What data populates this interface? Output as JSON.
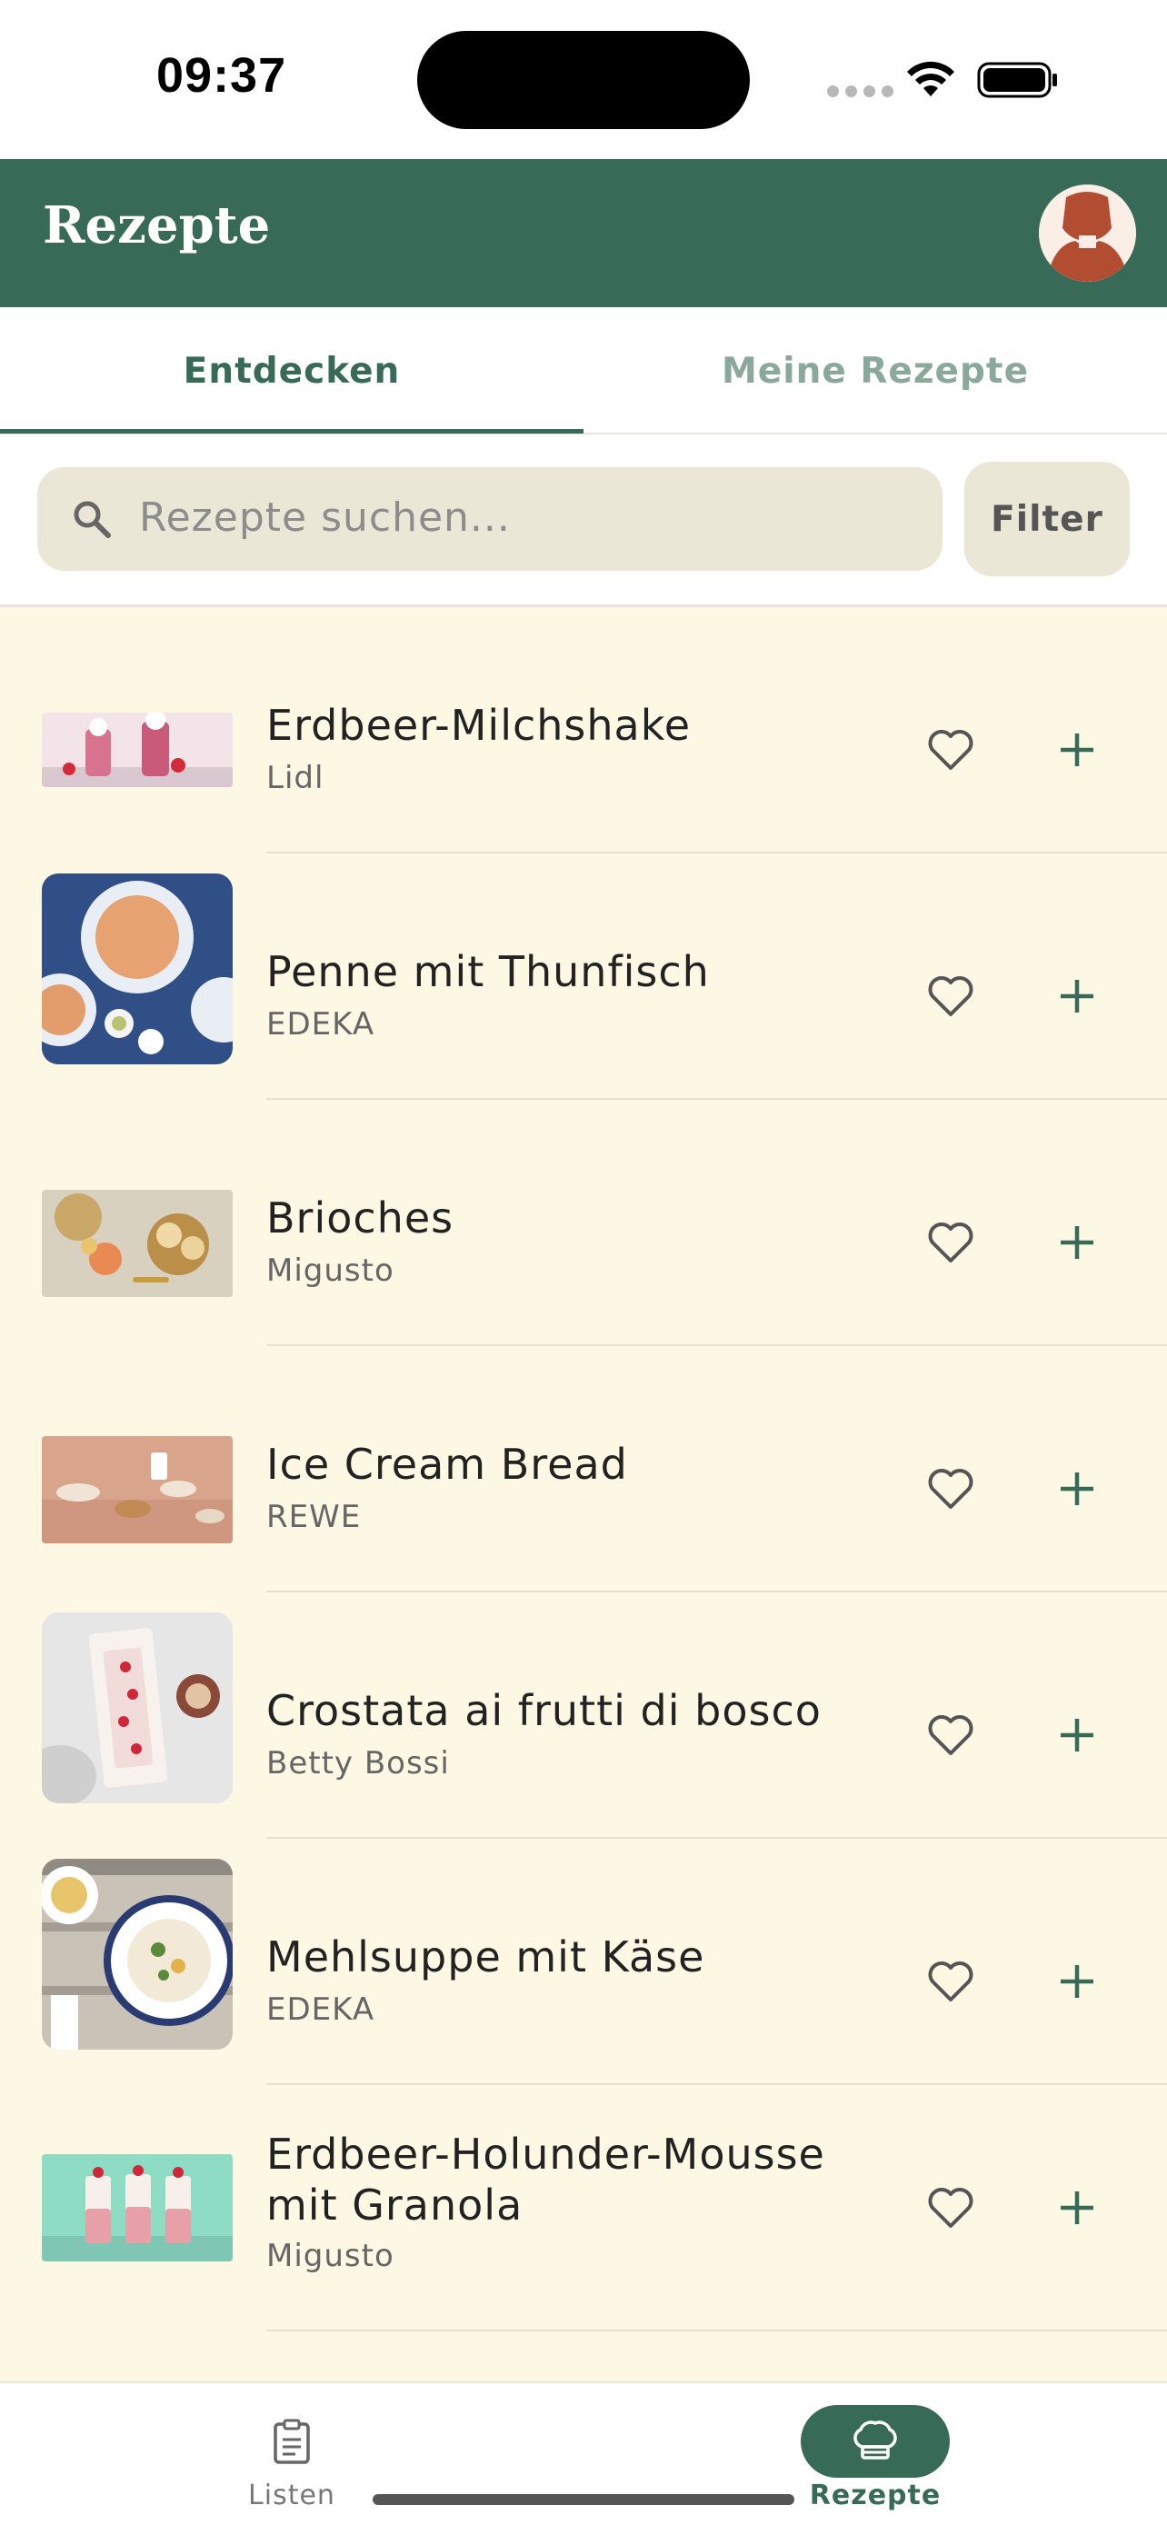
{
  "status_bar": {
    "time": "09:37"
  },
  "header": {
    "title": "Rezepte",
    "brand_color": "#386a58"
  },
  "tabs": [
    {
      "label": "Entdecken",
      "active": true
    },
    {
      "label": "Meine Rezepte",
      "active": false
    }
  ],
  "search": {
    "placeholder": "Rezepte suchen...",
    "value": "",
    "filter_label": "Filter"
  },
  "recipes": [
    {
      "name": "Erdbeer-Milchshake",
      "source": "Lidl",
      "favorite": false
    },
    {
      "name": "Penne mit Thunfisch",
      "source": "EDEKA",
      "favorite": false
    },
    {
      "name": "Brioches",
      "source": "Migusto",
      "favorite": false
    },
    {
      "name": "Ice Cream Bread",
      "source": "REWE",
      "favorite": false
    },
    {
      "name": "Crostata ai frutti di bosco",
      "source": "Betty Bossi",
      "favorite": false
    },
    {
      "name": "Mehlsuppe mit Käse",
      "source": "EDEKA",
      "favorite": false
    },
    {
      "name": "Erdbeer-Holunder-Mousse mit Granola",
      "source": "Migusto",
      "favorite": false
    }
  ],
  "bottom_nav": [
    {
      "label": "Listen",
      "icon": "clipboard-icon",
      "active": false
    },
    {
      "label": "Rezepte",
      "icon": "chef-hat-icon",
      "active": true
    }
  ]
}
